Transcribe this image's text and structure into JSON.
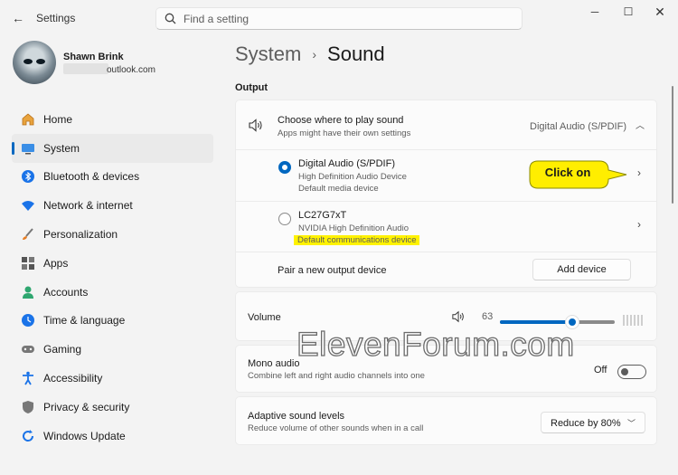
{
  "window": {
    "app_title": "Settings",
    "back_icon": "back-arrow-icon",
    "minimize_icon": "minimize-icon",
    "maximize_icon": "maximize-icon",
    "close_icon": "close-icon"
  },
  "search": {
    "placeholder": "Find a setting",
    "icon": "search-icon"
  },
  "user": {
    "name": "Shawn Brink",
    "email": "outlook.com"
  },
  "sidebar": {
    "items": [
      {
        "label": "Home",
        "icon": "home-icon",
        "active": false
      },
      {
        "label": "System",
        "icon": "system-icon",
        "active": true
      },
      {
        "label": "Bluetooth & devices",
        "icon": "bluetooth-icon",
        "active": false
      },
      {
        "label": "Network & internet",
        "icon": "wifi-icon",
        "active": false
      },
      {
        "label": "Personalization",
        "icon": "brush-icon",
        "active": false
      },
      {
        "label": "Apps",
        "icon": "apps-icon",
        "active": false
      },
      {
        "label": "Accounts",
        "icon": "accounts-icon",
        "active": false
      },
      {
        "label": "Time & language",
        "icon": "clock-globe-icon",
        "active": false
      },
      {
        "label": "Gaming",
        "icon": "gamepad-icon",
        "active": false
      },
      {
        "label": "Accessibility",
        "icon": "accessibility-icon",
        "active": false
      },
      {
        "label": "Privacy & security",
        "icon": "shield-icon",
        "active": false
      },
      {
        "label": "Windows Update",
        "icon": "update-icon",
        "active": false
      }
    ]
  },
  "breadcrumb": {
    "root": "System",
    "separator": "›",
    "current": "Sound"
  },
  "output": {
    "section_title": "Output",
    "choose": {
      "title": "Choose where to play sound",
      "subtitle": "Apps might have their own settings",
      "value": "Digital Audio (S/PDIF)",
      "icon": "speaker-icon"
    },
    "devices": [
      {
        "name": "Digital Audio (S/PDIF)",
        "description": "High Definition Audio Device",
        "role": "Default media device",
        "selected": true
      },
      {
        "name": "LC27G7xT",
        "description": "NVIDIA High Definition Audio",
        "role": "Default communications device",
        "selected": false
      }
    ],
    "pair": {
      "label": "Pair a new output device",
      "button": "Add device"
    }
  },
  "annotation": {
    "callout_text": "Click on"
  },
  "volume": {
    "label": "Volume",
    "value": "63",
    "level": 0.63,
    "icon": "speaker-icon"
  },
  "mono": {
    "title": "Mono audio",
    "subtitle": "Combine left and right audio channels into one",
    "state": "Off"
  },
  "adaptive": {
    "title": "Adaptive sound levels",
    "subtitle": "Reduce volume of other sounds when in a call",
    "selected": "Reduce by 80%"
  },
  "watermark": "ElevenForum.com",
  "colors": {
    "accent": "#0067c0",
    "highlight": "#fff200",
    "callout": "#ffee00"
  }
}
